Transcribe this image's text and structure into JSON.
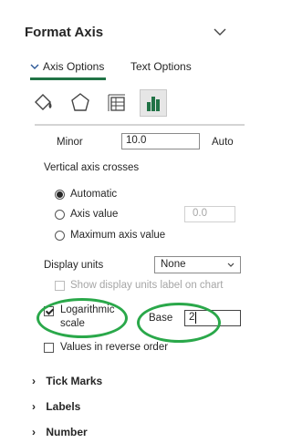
{
  "pane": {
    "title": "Format Axis",
    "tabs": [
      {
        "label": "Axis Options",
        "active": true
      },
      {
        "label": "Text Options",
        "active": false
      }
    ],
    "icons": [
      "fill-line-icon",
      "effects-icon",
      "size-properties-icon",
      "axis-options-icon"
    ]
  },
  "minor": {
    "label": "Minor",
    "value": "10.0",
    "mode": "Auto"
  },
  "axis_crosses": {
    "label": "Vertical axis crosses",
    "options": [
      {
        "label": "Automatic",
        "selected": true
      },
      {
        "label": "Axis value",
        "value": "0.0",
        "selected": false
      },
      {
        "label": "Maximum axis value",
        "selected": false
      }
    ]
  },
  "display_units": {
    "label": "Display units",
    "value": "None",
    "show_label": {
      "label": "Show display units label on chart",
      "checked": false,
      "disabled": true
    }
  },
  "log_scale": {
    "label_line1": "Logarithmic",
    "label_line2": "scale",
    "checked": true,
    "base_label": "Base",
    "base_value": "2"
  },
  "reverse_order": {
    "label": "Values in reverse order",
    "checked": false
  },
  "sections": [
    {
      "label": "Tick Marks"
    },
    {
      "label": "Labels"
    },
    {
      "label": "Number"
    }
  ],
  "colors": {
    "accent": "#217346",
    "annotation": "#2aa84a",
    "text": "#262626"
  }
}
